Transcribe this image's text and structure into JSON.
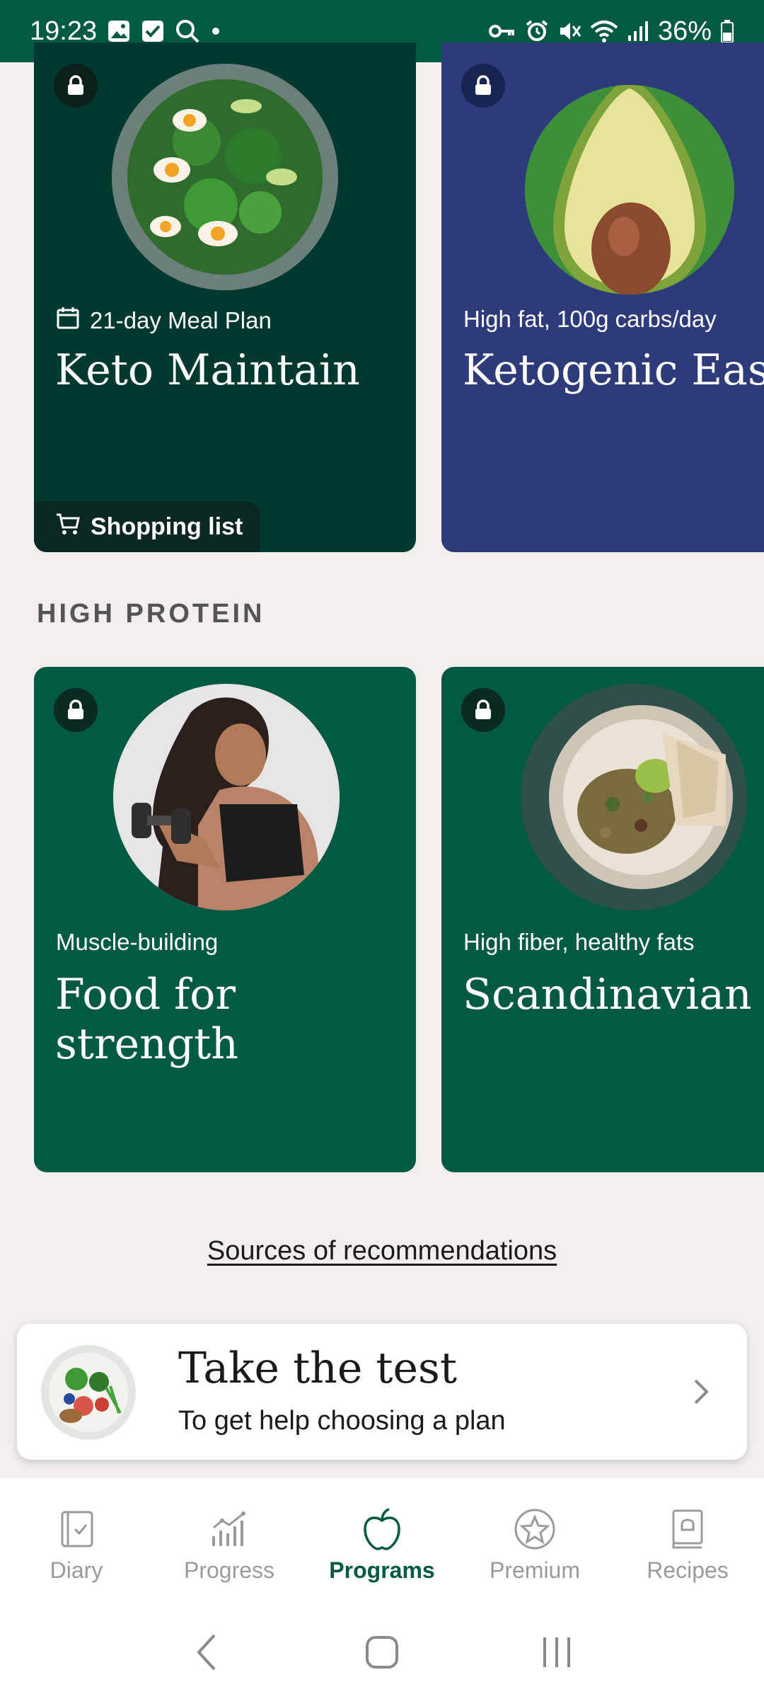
{
  "status_bar": {
    "time": "19:23",
    "battery": "36%"
  },
  "cards_top": [
    {
      "subtitle": "21-day Meal Plan",
      "title": "Keto Maintain",
      "shopping_label": "Shopping list"
    },
    {
      "subtitle": "High fat, 100g carbs/day",
      "title": "Ketogenic Easy"
    }
  ],
  "section": {
    "heading": "HIGH PROTEIN"
  },
  "cards_protein": [
    {
      "subtitle": "Muscle-building",
      "title": "Food for strength"
    },
    {
      "subtitle": "High fiber, healthy fats",
      "title": "Scandinavian"
    }
  ],
  "sources_link": "Sources of recommendations",
  "test": {
    "title": "Take the test",
    "subtitle": "To get help choosing a plan"
  },
  "bottom_nav": {
    "items": [
      {
        "label": "Diary",
        "icon": "diary-icon"
      },
      {
        "label": "Progress",
        "icon": "progress-icon"
      },
      {
        "label": "Programs",
        "icon": "apple-icon",
        "active": true
      },
      {
        "label": "Premium",
        "icon": "star-icon"
      },
      {
        "label": "Recipes",
        "icon": "book-icon"
      }
    ]
  },
  "colors": {
    "brand_green": "#035a43",
    "dark_green": "#003a2e",
    "navy": "#2d3b7a",
    "background": "#f1eeeb"
  }
}
